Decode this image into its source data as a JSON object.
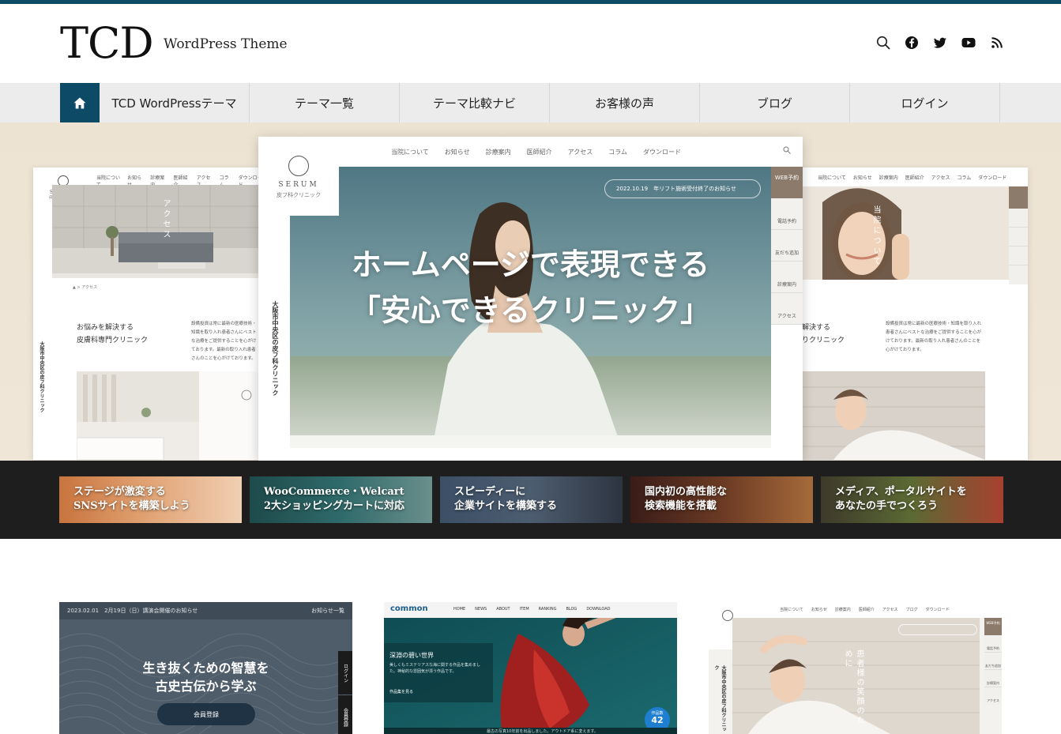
{
  "header": {
    "logo": "TCD",
    "tagline": "WordPress Theme",
    "icons": [
      "search-icon",
      "facebook-icon",
      "twitter-icon",
      "youtube-icon",
      "rss-icon"
    ]
  },
  "nav": {
    "home_icon": "home-icon",
    "items": [
      "TCD WordPressテーマ",
      "テーマ一覧",
      "テーマ比較ナビ",
      "お客様の声",
      "ブログ",
      "ログイン"
    ]
  },
  "hero": {
    "copy_line1": "ホームページで表現できる",
    "copy_line2": "「安心できるクリニック」",
    "main_card": {
      "brand": "SERUM",
      "brand_sub": "皮フ科クリニック",
      "nav": [
        "当院について",
        "お知らせ",
        "診療案内",
        "医師紹介",
        "アクセス",
        "コラム",
        "ダウンロード"
      ],
      "notice": "2022.10.19　年リフト施術受付終了のお知らせ",
      "vertical_text": "大阪市中央区の皮フ科クリニック",
      "side_buttons": [
        "WEB予約",
        "電話予約",
        "友だち追加",
        "診療案内",
        "アクセス"
      ]
    },
    "left_card": {
      "brand": "SERUM",
      "brand_sub": "皮フ科クリニック",
      "nav": [
        "当院について",
        "お知らせ",
        "診療案内",
        "医師紹介",
        "アクセス",
        "コラム",
        "ダウンロード"
      ],
      "photo_caption": "アクセス",
      "breadcrumb": "アクセス",
      "vertical_text": "大阪市中央区の皮フ科クリニック",
      "heading_line1": "お悩みを解決する",
      "heading_line2": "皮膚科専門クリニック",
      "body": "設備投資は常に最新の医療技術・知識を取り入れ患者さんにベストな治療をご提供することを心がけております。最新の取り入れ患者さんのことを心がけております。"
    },
    "right_card": {
      "nav": [
        "当院について",
        "お知らせ",
        "診療案内",
        "医師紹介",
        "アクセス",
        "コラム",
        "ダウンロード"
      ],
      "photo_caption": "当院について",
      "heading_line1": "解決する",
      "heading_line2": "りクリニック",
      "body": "設備投資は常に最新の医療技術・知識を取り入れ患者さんにベストな治療をご提供することを心がけております。最新の取り入れ患者さんのことを心がけております。"
    }
  },
  "banners": [
    {
      "line1": "ステージが激変する",
      "line2": "SNSサイトを構築しよう"
    },
    {
      "line1": "WooCommerce・Welcart",
      "line2": "2大ショッピングカートに対応"
    },
    {
      "line1": "スピーディーに",
      "line2": "企業サイトを構築する"
    },
    {
      "line1": "国内初の高性能な",
      "line2": "検索機能を搭載"
    },
    {
      "line1": "メディア、ポータルサイトを",
      "line2": "あなたの手でつくろう"
    }
  ],
  "thumbs": [
    {
      "topbar": "2023.02.01　2月19日（日）講演会開催のお知らせ",
      "topbar_link": "お知らせ一覧",
      "copy_line1": "生き抜くための智慧を",
      "copy_line2": "古史古伝から学ぶ",
      "button": "会員登録",
      "side1": "ログイン",
      "side2": "会員登録"
    },
    {
      "logo": "common",
      "nav": [
        "HOME",
        "NEWS",
        "ABOUT",
        "ITEM",
        "RANKING",
        "BLOG",
        "DOWNLOAD"
      ],
      "heading": "深淵の碧い世界",
      "body": "美しくもミステリアスな海に関する作品を集めました。神秘的な雰囲気が漂う作品です。",
      "link": "作品集を見る",
      "badge_label": "作品数",
      "badge_value": "42",
      "footer_text": "最古の写真10年前を出品しました。アウトドア系に変えます。"
    },
    {
      "nav": [
        "当院について",
        "お知らせ",
        "診療案内",
        "医師紹介",
        "アクセス",
        "ブログ",
        "ダウンロード"
      ],
      "vertical_text": "大阪市中央区の皮フ科クリニック",
      "copy": "患者様の笑顔のために",
      "side_buttons": [
        "WEB予約",
        "電話予約",
        "友だち追加",
        "診療案内",
        "アクセス"
      ]
    }
  ]
}
